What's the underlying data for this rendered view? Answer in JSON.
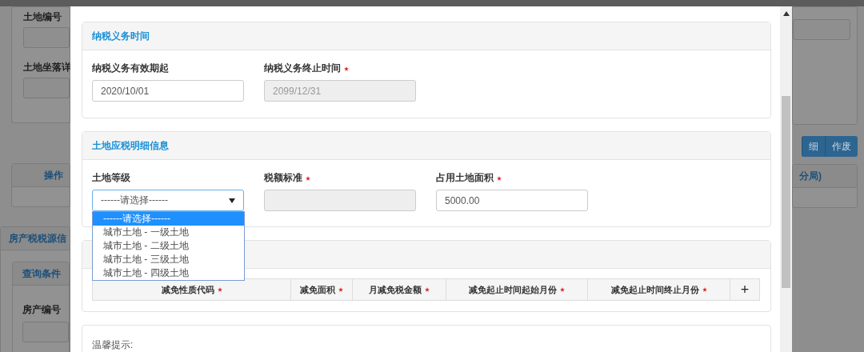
{
  "background": {
    "land_number_label": "土地编号",
    "land_location_label": "土地坐落详",
    "table_column": "操作",
    "panel_title": "房产税税源信",
    "subpanel_title": "查询条件",
    "property_number_label": "房产编号",
    "buttons": [
      "细",
      "作废"
    ],
    "right_table_column": "分局)"
  },
  "modal": {
    "tax_period": {
      "title": "纳税义务时间",
      "fields": [
        {
          "label": "纳税义务有效期起",
          "required": false,
          "value": "2020/10/01",
          "disabled": false
        },
        {
          "label": "纳税义务终止时间",
          "required": true,
          "value": "2099/12/31",
          "disabled": true
        }
      ]
    },
    "land_detail": {
      "title": "土地应税明细信息",
      "fields": [
        {
          "kind": "select",
          "label": "土地等级",
          "required": false,
          "value": "------请选择------",
          "expanded": true,
          "options": [
            {
              "label": "------请选择------",
              "selected": true
            },
            {
              "label": "城市土地 - 一级土地",
              "selected": false
            },
            {
              "label": "城市土地 - 二级土地",
              "selected": false
            },
            {
              "label": "城市土地 - 三级土地",
              "selected": false
            },
            {
              "label": "城市土地 - 四级土地",
              "selected": false
            }
          ]
        },
        {
          "kind": "text",
          "label": "税额标准",
          "required": true,
          "disabled": true
        },
        {
          "kind": "text",
          "label": "占用土地面积",
          "required": true,
          "value": "5000.00",
          "disabled": false
        }
      ]
    },
    "relief": {
      "columns": [
        {
          "label": "减免性质代码",
          "required": true
        },
        {
          "label": "减免面积",
          "required": true
        },
        {
          "label": "月减免税金额",
          "required": true
        },
        {
          "label": "减免起止时间起始月份",
          "required": true
        },
        {
          "label": "减免起止时间终止月份",
          "required": true
        }
      ],
      "add_button": "+"
    },
    "tips": {
      "label": "温馨提示:"
    }
  }
}
